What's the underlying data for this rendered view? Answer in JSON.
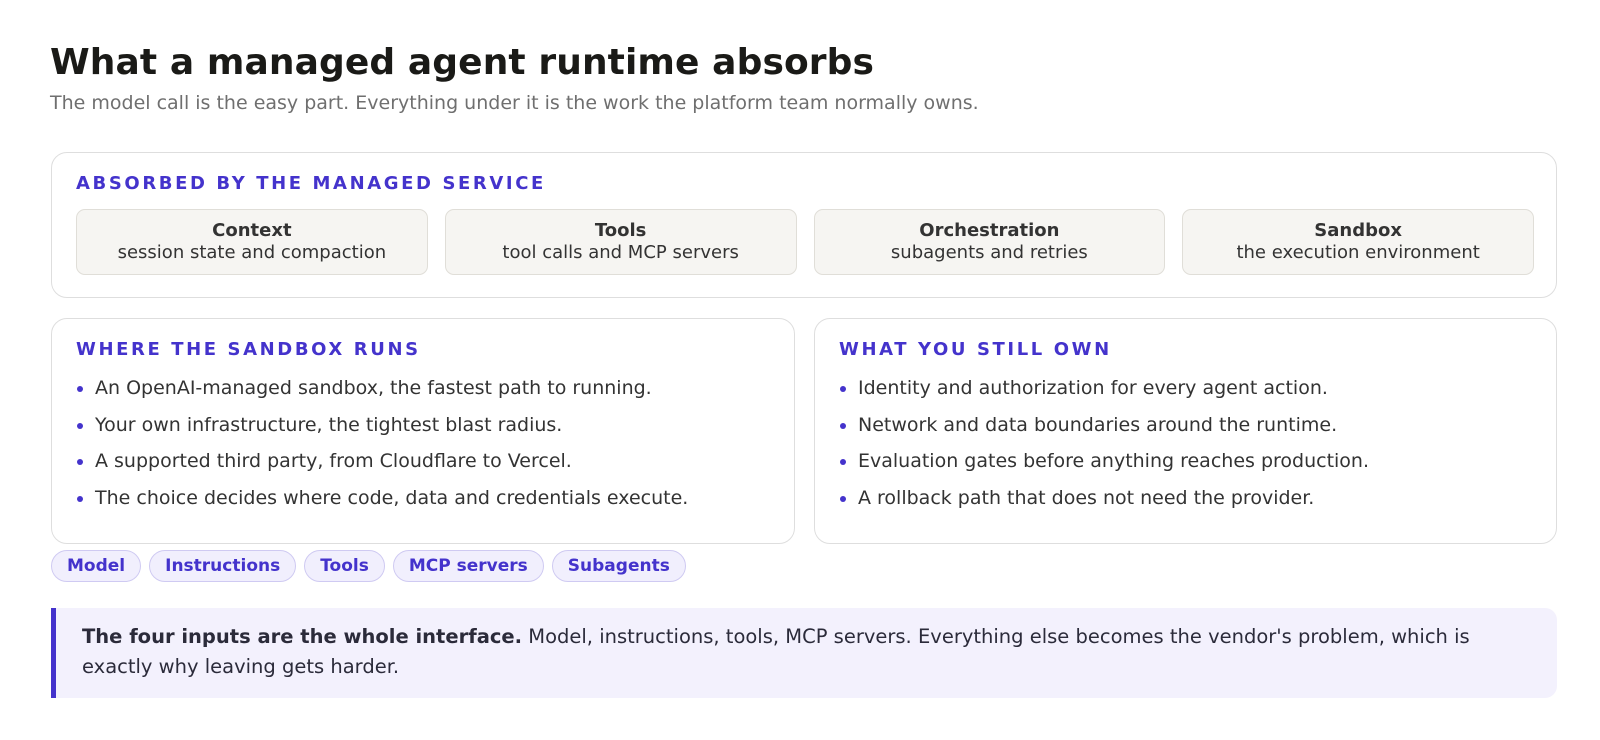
{
  "header": {
    "title": "What a managed agent runtime absorbs",
    "subtitle": "The model call is the easy part. Everything under it is the work the platform team normally owns."
  },
  "absorbed": {
    "heading": "ABSORBED BY THE MANAGED SERVICE",
    "cards": [
      {
        "title": "Context",
        "desc": "session state and compaction"
      },
      {
        "title": "Tools",
        "desc": "tool calls and MCP servers"
      },
      {
        "title": "Orchestration",
        "desc": "subagents and retries"
      },
      {
        "title": "Sandbox",
        "desc": "the execution environment"
      }
    ]
  },
  "sandbox": {
    "heading": "WHERE THE SANDBOX RUNS",
    "items": [
      "An OpenAI-managed sandbox, the fastest path to running.",
      "Your own infrastructure, the tightest blast radius.",
      "A supported third party, from Cloudflare to Vercel.",
      "The choice decides where code, data and credentials execute."
    ]
  },
  "own": {
    "heading": "WHAT YOU STILL OWN",
    "items": [
      "Identity and authorization for every agent action.",
      "Network and data boundaries around the runtime.",
      "Evaluation gates before anything reaches production.",
      "A rollback path that does not need the provider."
    ]
  },
  "chips": [
    "Model",
    "Instructions",
    "Tools",
    "MCP servers",
    "Subagents"
  ],
  "callout": {
    "lead": "The four inputs are the whole interface.",
    "body": " Model, instructions, tools, MCP servers. Everything else becomes the vendor's problem, which is exactly why leaving gets harder."
  },
  "colors": {
    "accent": "#4433cc",
    "card_bg": "#f6f5f2",
    "callout_bg": "#f3f1fd",
    "chip_bg": "#f1effd"
  }
}
